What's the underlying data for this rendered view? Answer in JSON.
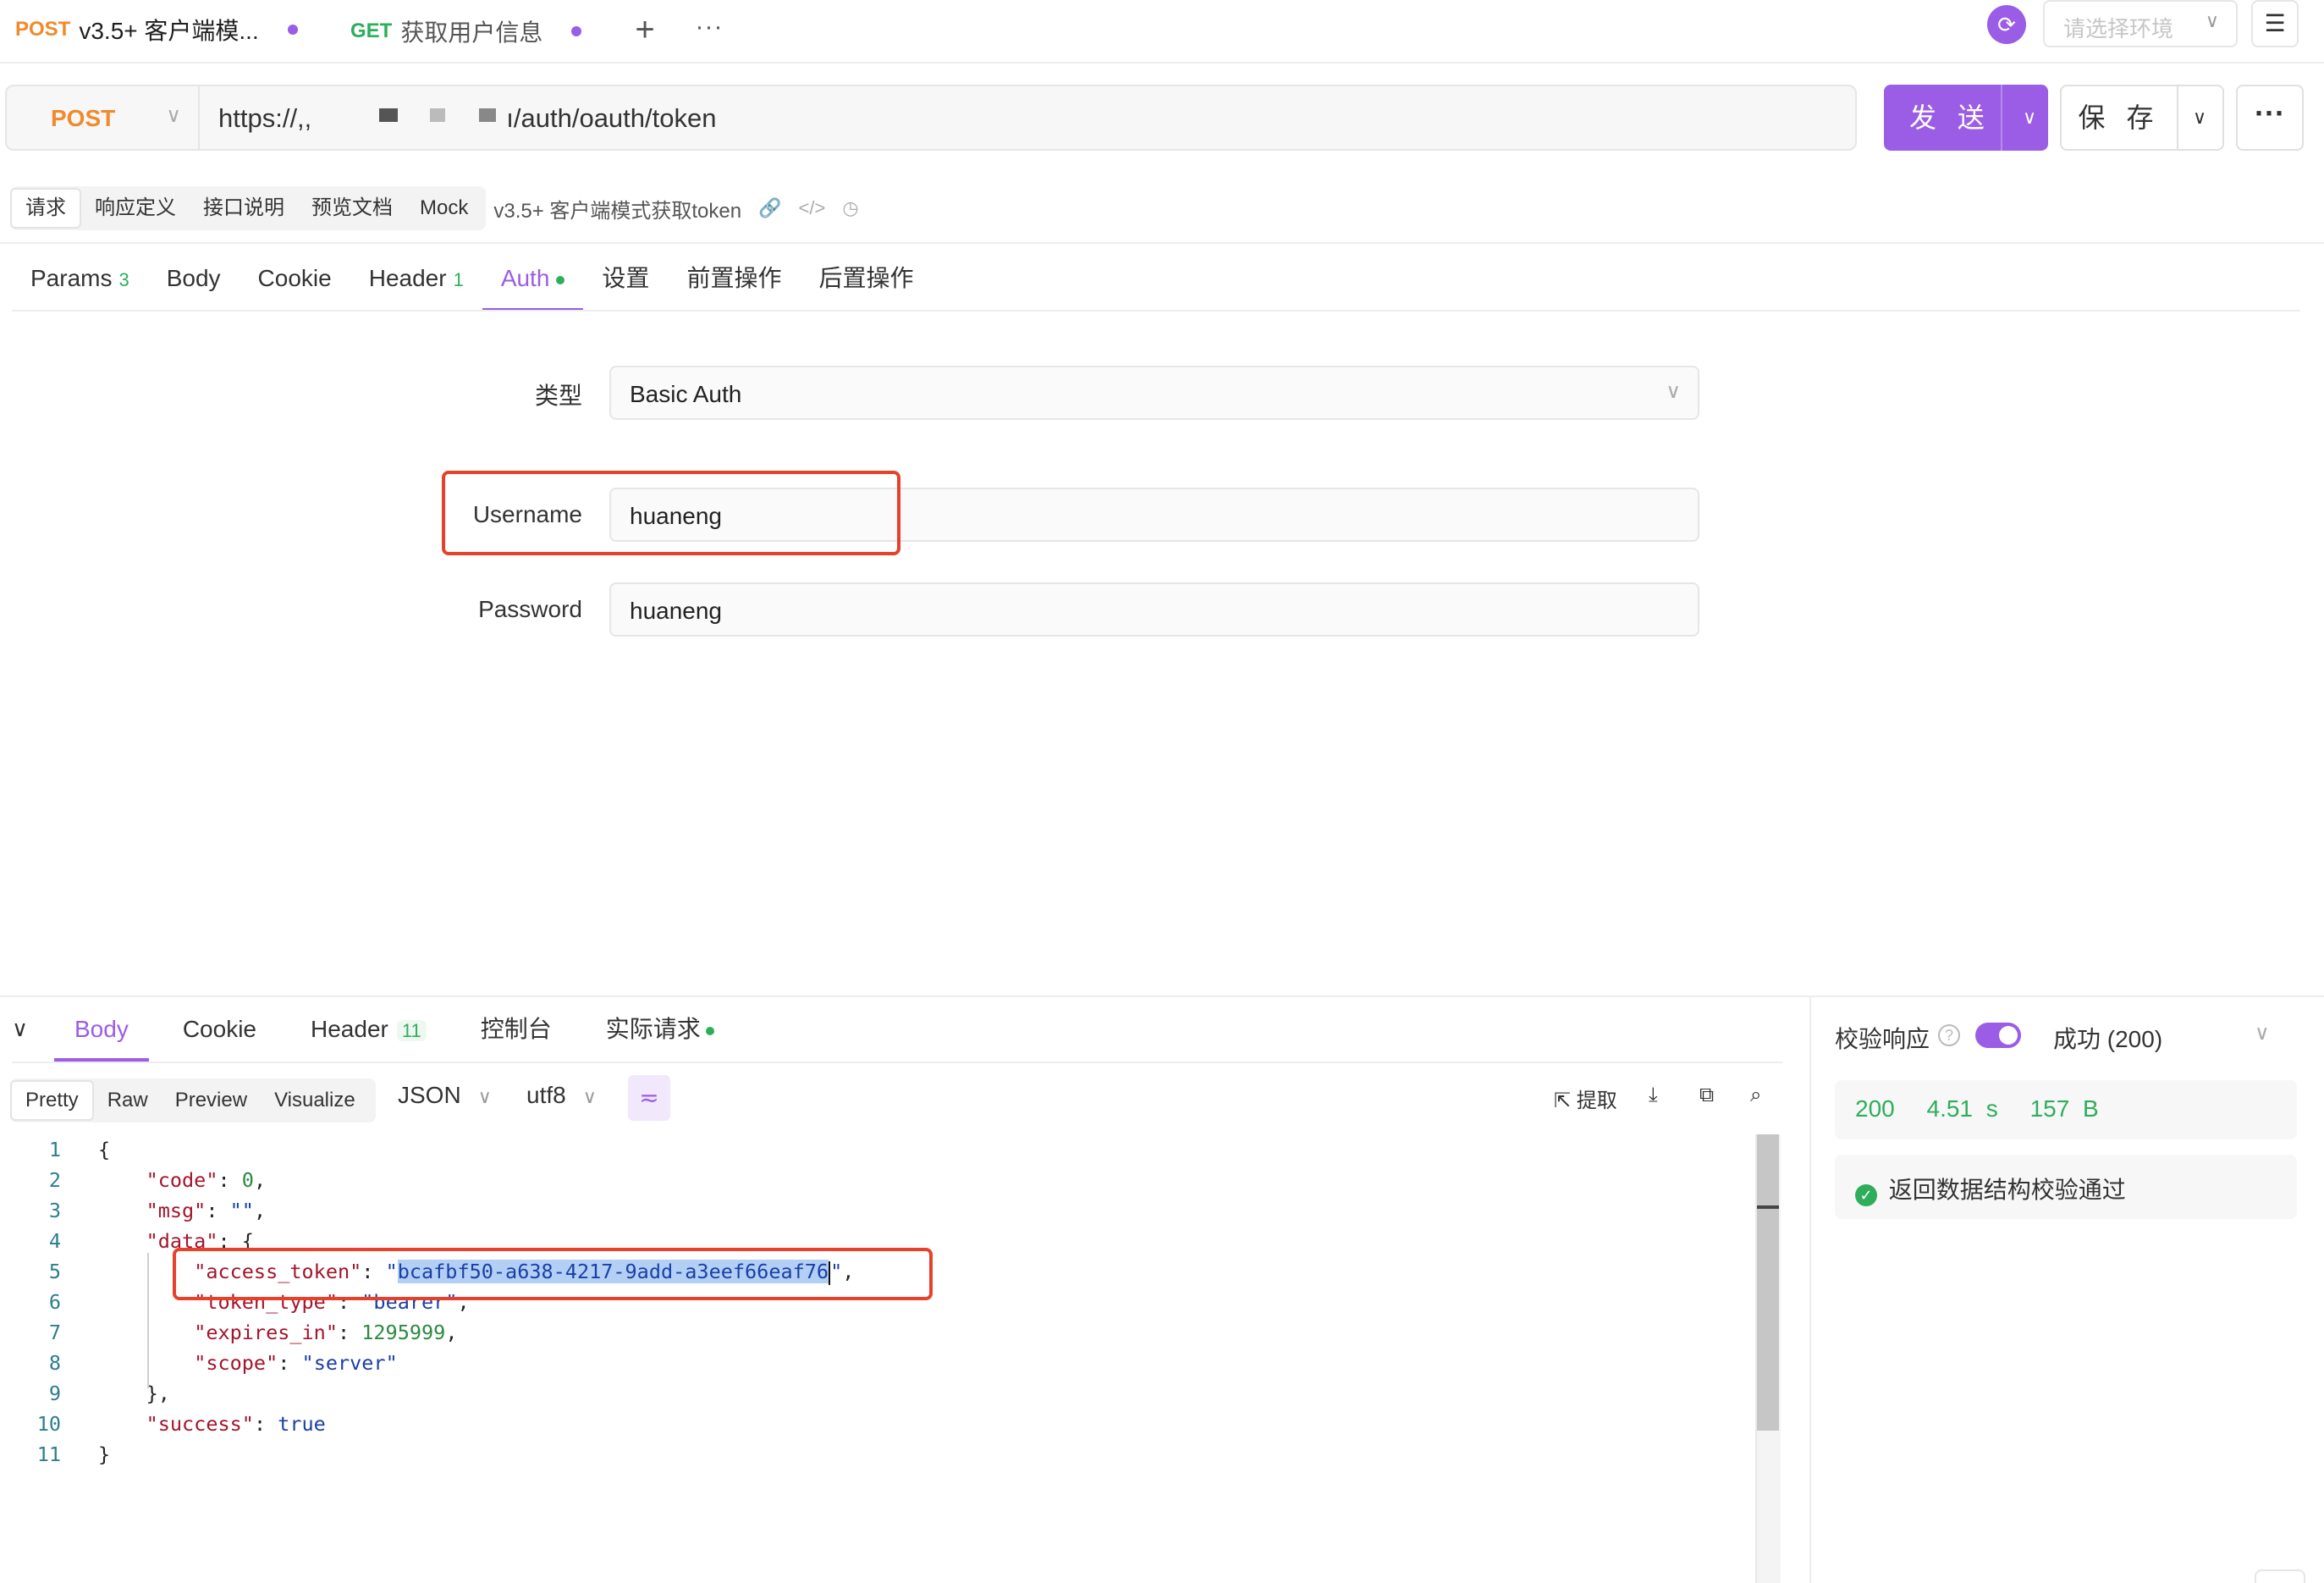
{
  "tabs": [
    {
      "method": "POST",
      "method_color": "#f08a2c",
      "title": "v3.5+ 客户端模..."
    },
    {
      "method": "GET",
      "method_color": "#2eae5a",
      "title": "获取用户信息"
    }
  ],
  "tabbar": {
    "add_icon": "plus-icon",
    "more_icon": "ellipsis-icon",
    "env_placeholder": "请选择环境"
  },
  "request": {
    "method": "POST",
    "url_prefix": "https:/",
    "url_partial": "/,,",
    "url_suffix": "ı/auth/oauth/token",
    "send_label": "发 送",
    "save_label": "保 存"
  },
  "subtabs": [
    "请求",
    "响应定义",
    "接口说明",
    "预览文档",
    "Mock"
  ],
  "api_name": "v3.5+ 客户端模式获取token",
  "request_tabs": [
    {
      "label": "Params",
      "count": "3"
    },
    {
      "label": "Body",
      "count": ""
    },
    {
      "label": "Cookie",
      "count": ""
    },
    {
      "label": "Header",
      "count": "1"
    },
    {
      "label": "Auth",
      "count": ""
    },
    {
      "label": "设置",
      "count": ""
    },
    {
      "label": "前置操作",
      "count": ""
    },
    {
      "label": "后置操作",
      "count": ""
    }
  ],
  "auth": {
    "type_label": "类型",
    "type_value": "Basic Auth",
    "username_label": "Username",
    "username_value": "huaneng",
    "password_label": "Password",
    "password_value": "huaneng"
  },
  "response_tabs": [
    {
      "label": "Body",
      "count": ""
    },
    {
      "label": "Cookie",
      "count": ""
    },
    {
      "label": "Header",
      "count": "11"
    },
    {
      "label": "控制台",
      "count": ""
    },
    {
      "label": "实际请求",
      "count": ""
    }
  ],
  "view_tabs": [
    "Pretty",
    "Raw",
    "Preview",
    "Visualize"
  ],
  "format": "JSON",
  "encoding": "utf8",
  "tools": {
    "extract_label": "提取"
  },
  "code_lines": [
    "1",
    "2",
    "3",
    "4",
    "5",
    "6",
    "7",
    "8",
    "9",
    "10",
    "11"
  ],
  "response_json": {
    "code": "0",
    "msg": "\"\"",
    "access_token": "bcafbf50-a638-4217-9add-a3eef66eaf76",
    "token_type": "bearer",
    "expires_in": "1295999",
    "scope": "server",
    "success": "true"
  },
  "validation": {
    "label": "校验响应",
    "status": "成功 (200)",
    "code": "200",
    "time": "4.51 s",
    "size": "157 B",
    "result": "返回数据结构校验通过"
  },
  "colors": {
    "accent": "#9b5de5",
    "success": "#2eae5a",
    "post": "#f08a2c",
    "highlight": "#e8412b"
  }
}
